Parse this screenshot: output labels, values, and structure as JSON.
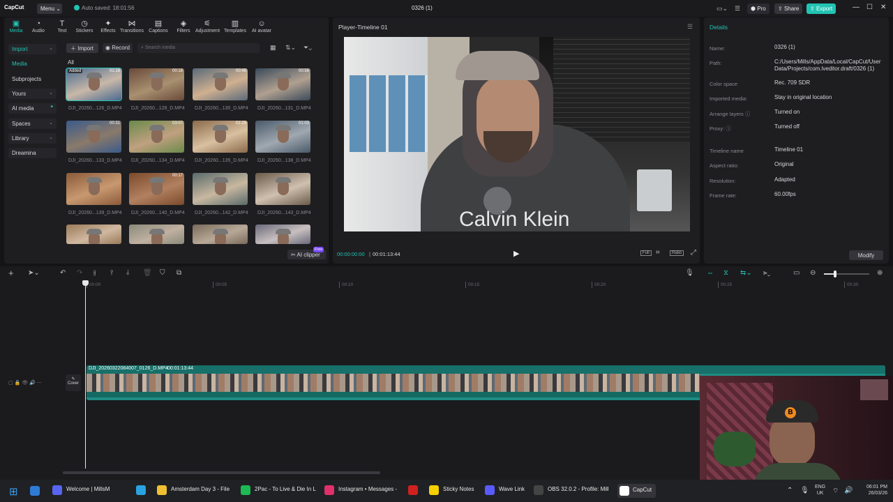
{
  "app": {
    "logo": "CapCut",
    "menu": "Menu ⌄",
    "autosave": "Auto saved: 18:01:56",
    "project_title": "0326 (1)",
    "pro": "Pro",
    "share": "Share",
    "export": "Export",
    "window_controls": [
      "—",
      "☐",
      "✕"
    ],
    "accent": "#22c3b3"
  },
  "toolbar_tabs": [
    {
      "label": "Media",
      "icon": "media-icon"
    },
    {
      "label": "Audio",
      "icon": "audio-icon"
    },
    {
      "label": "Text",
      "icon": "text-icon"
    },
    {
      "label": "Stickers",
      "icon": "stickers-icon"
    },
    {
      "label": "Effects",
      "icon": "effects-icon"
    },
    {
      "label": "Transitions",
      "icon": "transitions-icon"
    },
    {
      "label": "Captions",
      "icon": "captions-icon"
    },
    {
      "label": "Filters",
      "icon": "filters-icon"
    },
    {
      "label": "Adjustment",
      "icon": "adjustment-icon"
    },
    {
      "label": "Templates",
      "icon": "templates-icon"
    },
    {
      "label": "AI avatar",
      "icon": "ai-avatar-icon"
    }
  ],
  "sidebar": [
    {
      "label": "Import",
      "chev": "⌄"
    },
    {
      "label": "Media",
      "chev": ""
    },
    {
      "label": "Subprojects",
      "chev": ""
    },
    {
      "label": "Yours",
      "chev": "⌄"
    },
    {
      "label": "AI media",
      "chev": "•"
    },
    {
      "label": "Spaces",
      "chev": "⌄"
    },
    {
      "label": "Library",
      "chev": "⌄"
    },
    {
      "label": "Dreamina",
      "chev": ""
    }
  ],
  "media": {
    "import_btn": "Import",
    "record_btn": "Record",
    "search_placeholder": "Search media",
    "filter_all": "All",
    "added_badge": "Added",
    "ai_clipper": "AI clipper",
    "free_badge": "Free",
    "clips": [
      {
        "name": "DJI_20260...126_D.MP4",
        "dur": "01:18"
      },
      {
        "name": "DJI_20260...128_D.MP4",
        "dur": "00:18"
      },
      {
        "name": "DJI_20260...130_D.MP4",
        "dur": "00:48"
      },
      {
        "name": "DJI_20260...131_D.MP4",
        "dur": "00:56"
      },
      {
        "name": "DJI_20260...133_D.MP4",
        "dur": "00:31"
      },
      {
        "name": "DJI_20260...134_D.MP4",
        "dur": "03:07"
      },
      {
        "name": "DJI_20260...135_D.MP4",
        "dur": "01:29"
      },
      {
        "name": "DJI_20260...138_D.MP4",
        "dur": "01:03"
      },
      {
        "name": "DJI_20260...139_D.MP4",
        "dur": ""
      },
      {
        "name": "DJI_20260...140_D.MP4",
        "dur": "00:17"
      },
      {
        "name": "DJI_20260...142_D.MP4",
        "dur": ""
      },
      {
        "name": "DJI_20260...143_D.MP4",
        "dur": ""
      },
      {
        "name": "",
        "dur": ""
      },
      {
        "name": "",
        "dur": ""
      },
      {
        "name": "",
        "dur": ""
      },
      {
        "name": "",
        "dur": ""
      }
    ]
  },
  "player": {
    "title": "Player-Timeline 01",
    "current": "00:00:00:00",
    "total": "00:01:13:44",
    "full_label": "Full",
    "ratio_label": "Ratio"
  },
  "details": {
    "header": "Details",
    "rows": [
      {
        "k": "Name:",
        "v": "0326 (1)"
      },
      {
        "k": "Path:",
        "v": "C:/Users/Mills/AppData/Local/CapCut/User Data/Projects/com.lveditor.draft/0326 (1)"
      },
      {
        "k": "Color space",
        "v": "Rec. 709 SDR"
      },
      {
        "k": "Imported media:",
        "v": "Stay in original location"
      },
      {
        "k": "Arrange layers ⓘ",
        "v": "Turned on"
      },
      {
        "k": "Proxy: ⓘ",
        "v": "Turned off"
      },
      {
        "k": "Timeline name",
        "v": "Timeline 01"
      },
      {
        "k": "Aspect ratio:",
        "v": "Original"
      },
      {
        "k": "Resolution:",
        "v": "Adapted"
      },
      {
        "k": "Frame rate:",
        "v": "60.00fps"
      }
    ],
    "modify": "Modify"
  },
  "timeline": {
    "ticks": [
      "00:00",
      "00:05",
      "00:10",
      "00:15",
      "00:20",
      "00:25",
      "00:30"
    ],
    "clip_name": "DJI_20260322084007_0126_D.MP4",
    "clip_dur": "00:01:13:44",
    "cover": "Cover"
  },
  "taskbar": {
    "items": [
      {
        "label": "Welcome | MillsM",
        "color": "#5865f2"
      },
      {
        "label": "",
        "color": "#2aa3e0"
      },
      {
        "label": "Amsterdam Day 3 - File",
        "color": "#f0c030"
      },
      {
        "label": "2Pac - To Live & Die In L",
        "color": "#1db954"
      },
      {
        "label": "Instagram • Messages -",
        "color": "#e1306c"
      },
      {
        "label": "",
        "color": "#d02020"
      },
      {
        "label": "Sticky Notes",
        "color": "#f7d000"
      },
      {
        "label": "Wave Link",
        "color": "#5a5aff"
      },
      {
        "label": "OBS 32.0.2 - Profile: Mill",
        "color": "#444"
      },
      {
        "label": "CapCut",
        "color": "#ffffff"
      }
    ],
    "lang": "ENG",
    "region": "UK",
    "time": "06:01 PM",
    "date": "26/03/26"
  }
}
